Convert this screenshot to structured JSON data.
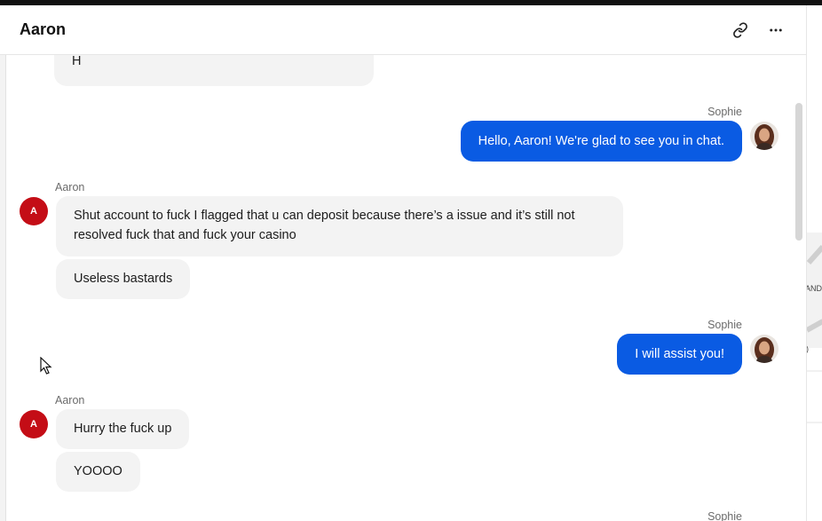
{
  "header": {
    "title": "Aaron",
    "link_icon": "link-icon",
    "more_icon": "more-horizontal-icon"
  },
  "messages": {
    "m0": {
      "text": "H"
    },
    "m1": {
      "sender": "Sophie",
      "text": "Hello, Aaron! We're glad to see you in chat."
    },
    "m2": {
      "sender": "Aaron",
      "avatar": "A",
      "line1": "Shut account to fuck I flagged that u can deposit because there’s a issue and it’s still not",
      "line2": "resolved fuck that and fuck your casino"
    },
    "m3": {
      "text": "Useless bastards"
    },
    "m4": {
      "sender": "Sophie",
      "text": "I will assist you!"
    },
    "m5": {
      "sender": "Aaron",
      "avatar": "A",
      "text": "Hurry the fuck up"
    },
    "m6": {
      "text": "YOOOO"
    },
    "m7": {
      "sender": "Sophie"
    }
  },
  "map_fragment": {
    "label1": "AND",
    "label2": ")"
  },
  "colors": {
    "outgoing_bubble": "#0a5be3",
    "incoming_bubble": "#f3f3f3",
    "aaron_avatar": "#c40d16"
  }
}
